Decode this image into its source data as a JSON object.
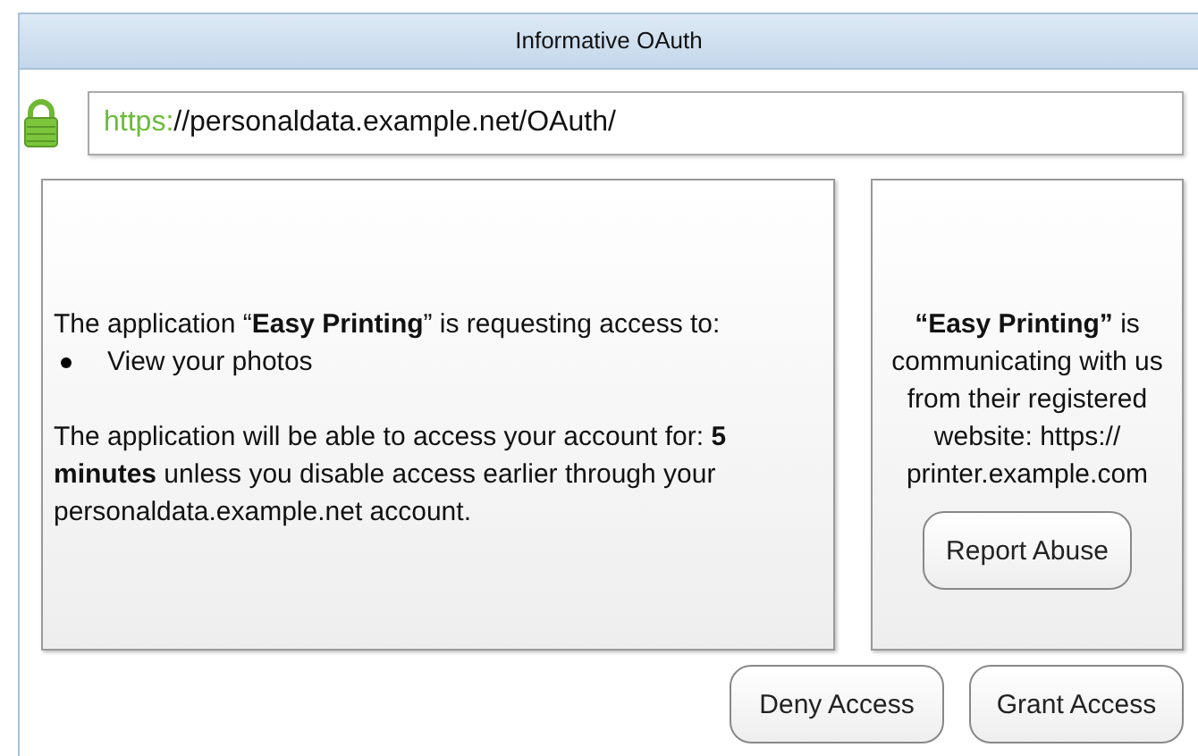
{
  "window": {
    "title": "Informative OAuth"
  },
  "address": {
    "secure": true,
    "scheme": "https:",
    "rest": "//personaldata.example.net/OAuth/"
  },
  "request": {
    "intro": "The application “**Easy Printing**” is requesting access to:",
    "permissions": [
      "View your photos"
    ],
    "duration": "The application will be able to access your account for: **5 minutes** unless you disable access earlier through your personaldata.example.net account."
  },
  "origin": {
    "text": "**“Easy Printing”** is communicating with us from their registered website: https:// printer.example.com",
    "button": "Report Abuse"
  },
  "buttons": [
    "Deny Access",
    "Grant Access"
  ]
}
